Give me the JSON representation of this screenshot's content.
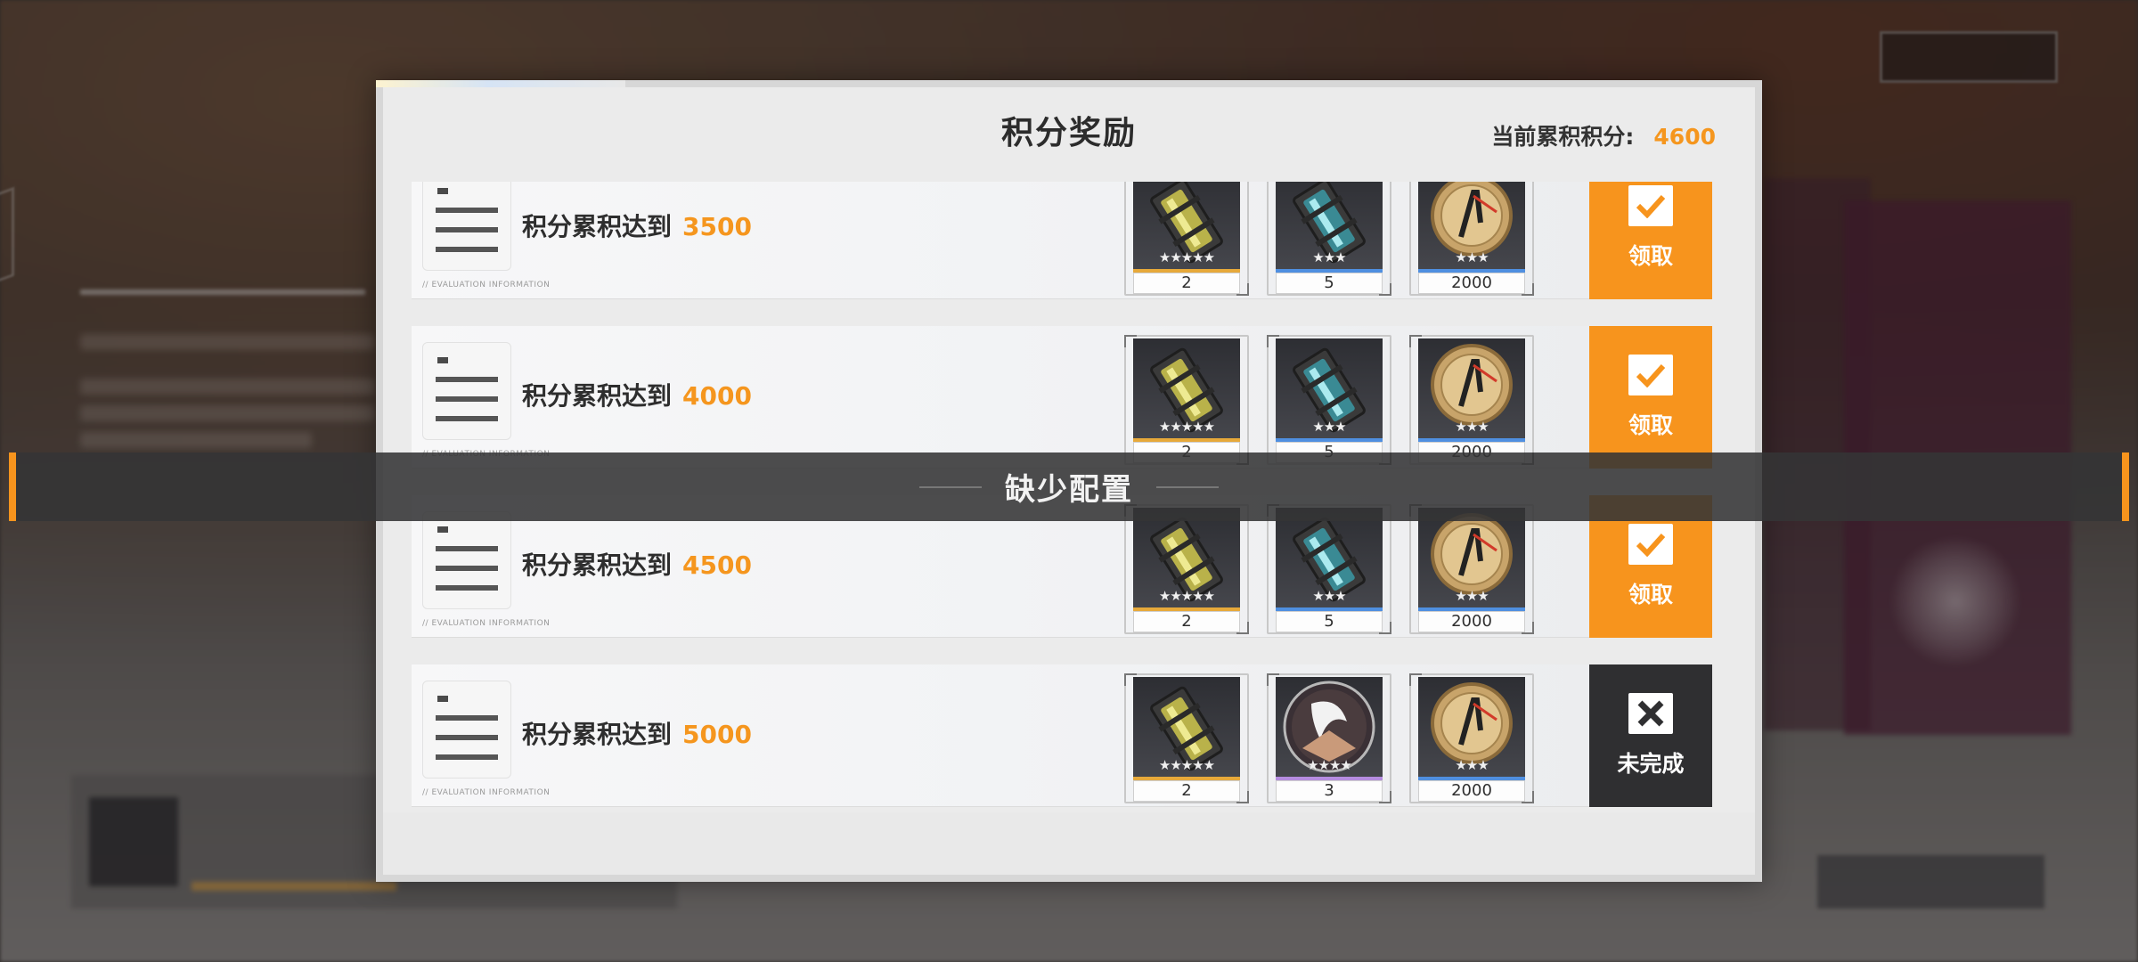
{
  "modal": {
    "title": "积分奖励",
    "score_label": "当前累积积分:",
    "score_value": "4600"
  },
  "rows": [
    {
      "label": "积分累积达到",
      "target": "3500",
      "eval": "EVALUATION INFORMATION",
      "items": [
        {
          "icon": "gold-crystal-icon",
          "rarity": "gold",
          "stars": "★★★★★",
          "count": "2"
        },
        {
          "icon": "blue-crystal-icon",
          "rarity": "blue",
          "stars": "★★★",
          "count": "5"
        },
        {
          "icon": "coin-icon",
          "rarity": "blue",
          "stars": "★★★",
          "count": "2000"
        }
      ],
      "action": {
        "label": "领取",
        "state": "claim"
      }
    },
    {
      "label": "积分累积达到",
      "target": "4000",
      "eval": "EVALUATION INFORMATION",
      "items": [
        {
          "icon": "gold-crystal-icon",
          "rarity": "gold",
          "stars": "★★★★★",
          "count": "2"
        },
        {
          "icon": "blue-crystal-icon",
          "rarity": "blue",
          "stars": "★★★",
          "count": "5"
        },
        {
          "icon": "coin-icon",
          "rarity": "blue",
          "stars": "★★★",
          "count": "2000"
        }
      ],
      "action": {
        "label": "领取",
        "state": "claim"
      }
    },
    {
      "label": "积分累积达到",
      "target": "4500",
      "eval": "EVALUATION INFORMATION",
      "items": [
        {
          "icon": "gold-crystal-icon",
          "rarity": "gold",
          "stars": "★★★★★",
          "count": "2"
        },
        {
          "icon": "blue-crystal-icon",
          "rarity": "blue",
          "stars": "★★★",
          "count": "5"
        },
        {
          "icon": "coin-icon",
          "rarity": "blue",
          "stars": "★★★",
          "count": "2000"
        }
      ],
      "action": {
        "label": "领取",
        "state": "claim"
      }
    },
    {
      "label": "积分累积达到",
      "target": "5000",
      "eval": "EVALUATION INFORMATION",
      "items": [
        {
          "icon": "gold-crystal-icon",
          "rarity": "gold",
          "stars": "★★★★★",
          "count": "2"
        },
        {
          "icon": "emblem-icon",
          "rarity": "purple",
          "stars": "★★★★",
          "count": "3"
        },
        {
          "icon": "coin-icon",
          "rarity": "blue",
          "stars": "★★★",
          "count": "2000"
        }
      ],
      "action": {
        "label": "未完成",
        "state": "incomplete"
      }
    }
  ],
  "toast": {
    "message": "缺少配置"
  },
  "colors": {
    "accent": "#f7941d",
    "incomplete": "#2f2f31"
  }
}
